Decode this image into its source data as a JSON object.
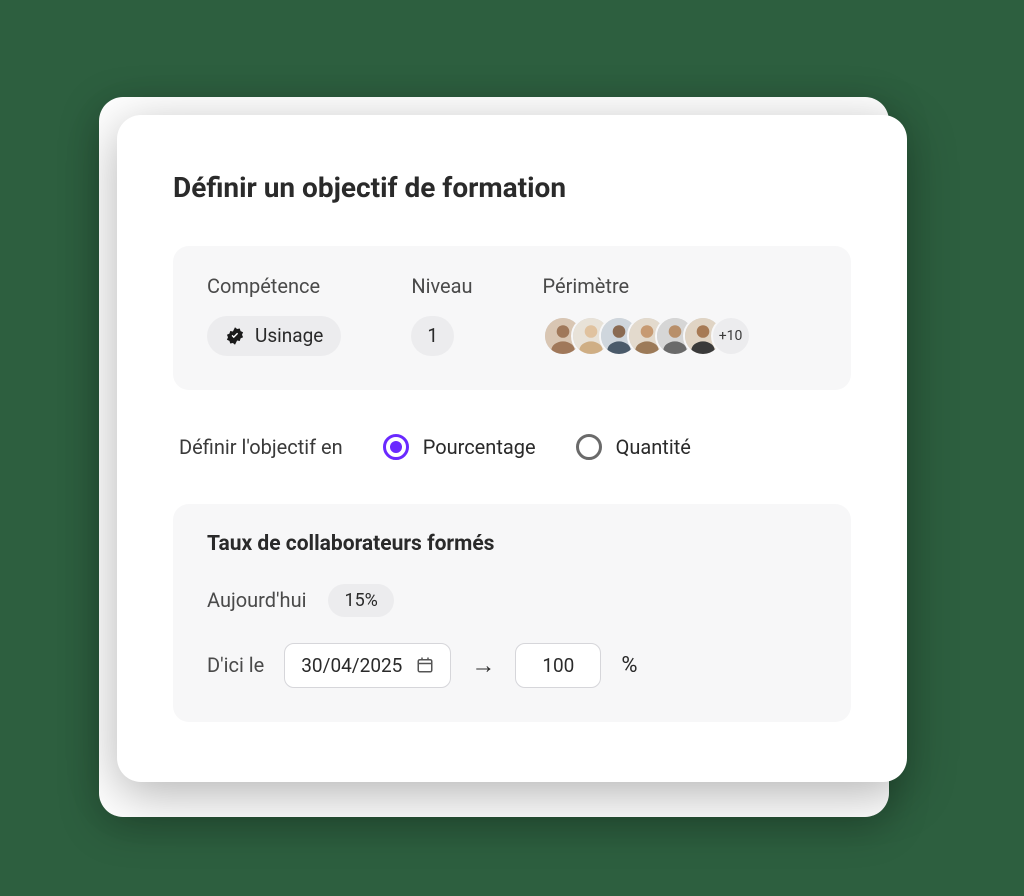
{
  "title": "Définir un objectif de formation",
  "summary": {
    "competence_label": "Compétence",
    "competence_value": "Usinage",
    "level_label": "Niveau",
    "level_value": "1",
    "perimeter_label": "Périmètre",
    "perimeter_more": "+10"
  },
  "define": {
    "prompt": "Définir l'objectif en",
    "opt_percent": "Pourcentage",
    "opt_quantity": "Quantité"
  },
  "rate": {
    "title": "Taux de collaborateurs formés",
    "today_label": "Aujourd'hui",
    "today_value": "15%",
    "by_label": "D'ici le",
    "date_value": "30/04/2025",
    "target_value": "100",
    "pct_symbol": "%"
  }
}
